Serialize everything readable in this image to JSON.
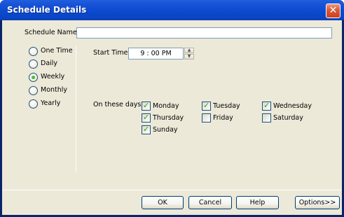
{
  "window": {
    "title": "Schedule Details",
    "close_glyph": "✕"
  },
  "schedule_name": {
    "label": "Schedule Name",
    "value": ""
  },
  "frequency": {
    "options": [
      {
        "label": "One Time",
        "selected": false
      },
      {
        "label": "Daily",
        "selected": false
      },
      {
        "label": "Weekly",
        "selected": true
      },
      {
        "label": "Monthly",
        "selected": false
      },
      {
        "label": "Yearly",
        "selected": false
      }
    ]
  },
  "start_time": {
    "label": "Start Time",
    "value": "9 : 00 PM"
  },
  "days": {
    "label": "On these days",
    "items": [
      {
        "label": "Monday",
        "checked": true
      },
      {
        "label": "Tuesday",
        "checked": true
      },
      {
        "label": "Wednesday",
        "checked": true
      },
      {
        "label": "Thursday",
        "checked": true
      },
      {
        "label": "Friday",
        "checked": false
      },
      {
        "label": "Saturday",
        "checked": false
      },
      {
        "label": "Sunday",
        "checked": true
      }
    ]
  },
  "buttons": {
    "ok": "OK",
    "cancel": "Cancel",
    "help": "Help",
    "options": "Options>>"
  },
  "colors": {
    "titlebar": "#0a4bd0",
    "client": "#ece9d8",
    "check": "#21a121",
    "close": "#d9593a"
  },
  "icons": {
    "close": "close-icon",
    "check": "checkmark-icon",
    "spinner_up": "spinner-up-icon",
    "spinner_down": "spinner-down-icon"
  }
}
